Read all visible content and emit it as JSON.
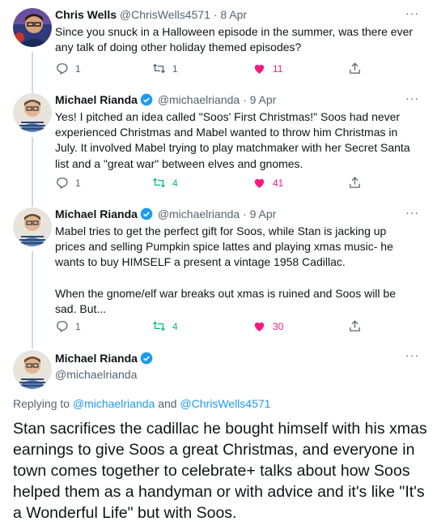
{
  "tweets": [
    {
      "name": "Chris Wells",
      "handle": "@ChrisWells4571",
      "date": "8 Apr",
      "verified": false,
      "text": "Since you snuck in a Halloween episode in the summer, was there ever any talk of doing other holiday themed episodes?",
      "replies": "1",
      "retweets": "1",
      "likes": "11"
    },
    {
      "name": "Michael Rianda",
      "handle": "@michaelrianda",
      "date": "9 Apr",
      "verified": true,
      "text": "Yes! I pitched an idea called \"Soos' First Christmas!\" Soos had never experienced Christmas and Mabel wanted to throw him Christmas in July. It involved Mabel trying to play matchmaker with her Secret Santa list and a \"great war\" between elves and gnomes.",
      "replies": "1",
      "retweets": "4",
      "likes": "41"
    },
    {
      "name": "Michael Rianda",
      "handle": "@michaelrianda",
      "date": "9 Apr",
      "verified": true,
      "text": "Mabel tries to get the perfect gift for Soos, while Stan is jacking up prices and selling Pumpkin spice lattes and playing xmas music- he wants to buy HIMSELF a present a vintage 1958 Cadillac.\n\nWhen the gnome/elf war breaks out xmas is ruined and Soos will be sad. But...",
      "replies": "1",
      "retweets": "4",
      "likes": "30"
    }
  ],
  "main_tweet": {
    "name": "Michael Rianda",
    "handle": "@michaelrianda",
    "verified": true,
    "replying_prefix": "Replying to",
    "replying_to_1": "@michaelrianda",
    "replying_and": "and",
    "replying_to_2": "@ChrisWells4571",
    "text": "Stan sacrifices the cadillac he bought himself with his xmas earnings to give Soos a great Christmas, and everyone in town comes together to celebrate+ talks about how Soos helped them as a handyman or with advice and it's like \"It's a Wonderful Life\" but with Soos."
  },
  "ui": {
    "more_label": "···",
    "dot": "·",
    "accent": "#1d9bf0",
    "retweet_color": "#00ba7c",
    "like_color": "#f91880"
  }
}
